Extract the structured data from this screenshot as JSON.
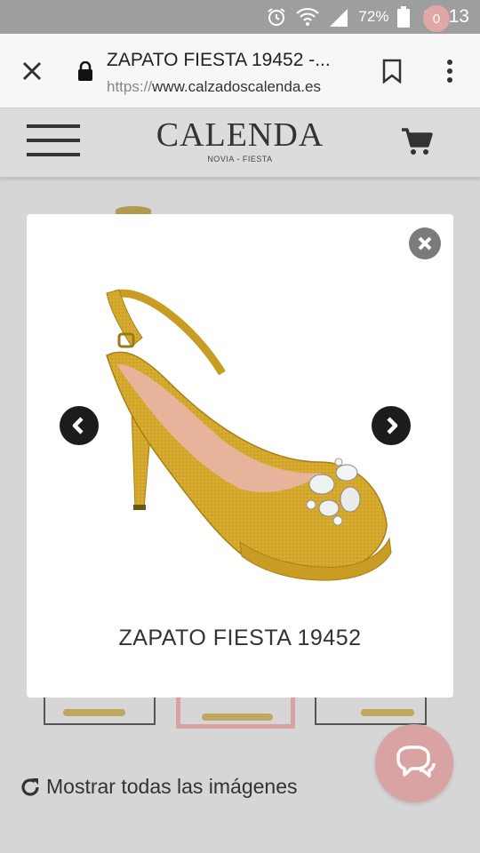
{
  "status_bar": {
    "battery_percent": "72%",
    "time": "13:13",
    "icons": [
      "alarm-icon",
      "wifi-icon",
      "signal-icon",
      "battery-icon"
    ]
  },
  "browser": {
    "page_title": "ZAPATO FIESTA 19452 -...",
    "url_scheme": "https://",
    "url_host": "www.calzadoscalenda.es",
    "icons": [
      "close-icon",
      "lock-icon",
      "bookmark-icon",
      "more-vert-icon"
    ]
  },
  "site_header": {
    "brand": "CALENDA",
    "tagline": "NOVIA - FIESTA",
    "cart_count": "0",
    "icons": [
      "menu-icon",
      "cart-icon"
    ]
  },
  "modal": {
    "caption": "ZAPATO FIESTA 19452",
    "icons": [
      "close-circle-icon",
      "chevron-left-icon",
      "chevron-right-icon"
    ]
  },
  "page": {
    "show_all_label": "Mostrar todas las imágenes",
    "icons": [
      "refresh-icon",
      "chat-icon"
    ]
  },
  "colors": {
    "accent_pink": "#d9a3a3",
    "shoe_yellow": "#d7ac2e",
    "status_bar_gray": "#9e9e9e"
  }
}
